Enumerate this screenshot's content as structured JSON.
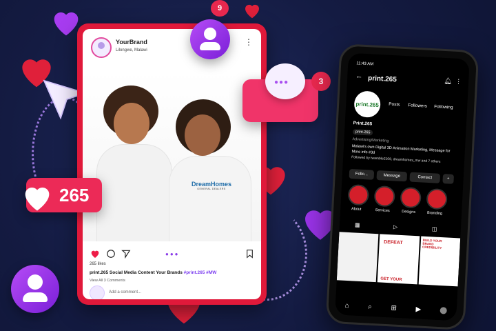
{
  "post": {
    "brand": "YourBrand",
    "location": "Lilongwe, Malawi",
    "likes": "265 likes",
    "caption_prefix": "print.265 Social Media Content Your Brands ",
    "caption_tags": "#print.265 #MW",
    "view_comments": "View All 3 Comments",
    "add_comment_placeholder": "Add a comment...",
    "shirt_logo": "DreamHomes",
    "shirt_sub": "GENERAL DEALERS"
  },
  "bubbles": {
    "like_count": "265",
    "badge_top": "9",
    "badge_chat": "3"
  },
  "phone": {
    "time": "11:43 AM",
    "username": "print.265",
    "logo_text": "print.265",
    "stats": [
      "Posts",
      "Followers",
      "Following"
    ],
    "display_name": "Print.265",
    "handle": "print.265",
    "category": "Advertising/Marketing",
    "bio": "Malawi's own Digital 3D Animation Marketing, Message for More info #3d",
    "followed_by": "Followed by twamble2109, dreamhomes_mw and 7 others",
    "buttons": [
      "Follo...",
      "Message",
      "Contact"
    ],
    "highlights": [
      "About",
      "Services",
      "Designs",
      "Branding"
    ],
    "grid_texts": [
      "DEFEAT",
      "GET YOUR",
      "BUILD YOUR BRAND CREDIBILITY"
    ]
  },
  "colors": {
    "accent": "#e0193a",
    "purple": "#8a2be2",
    "bg": "#141b42"
  },
  "icons": [
    "heart-icon",
    "comment-icon",
    "send-icon",
    "bookmark-icon",
    "user-icon",
    "chat-icon",
    "cursor-arrow-icon",
    "home-icon",
    "search-icon",
    "add-icon",
    "reels-icon",
    "bell-icon",
    "kebab-icon"
  ]
}
